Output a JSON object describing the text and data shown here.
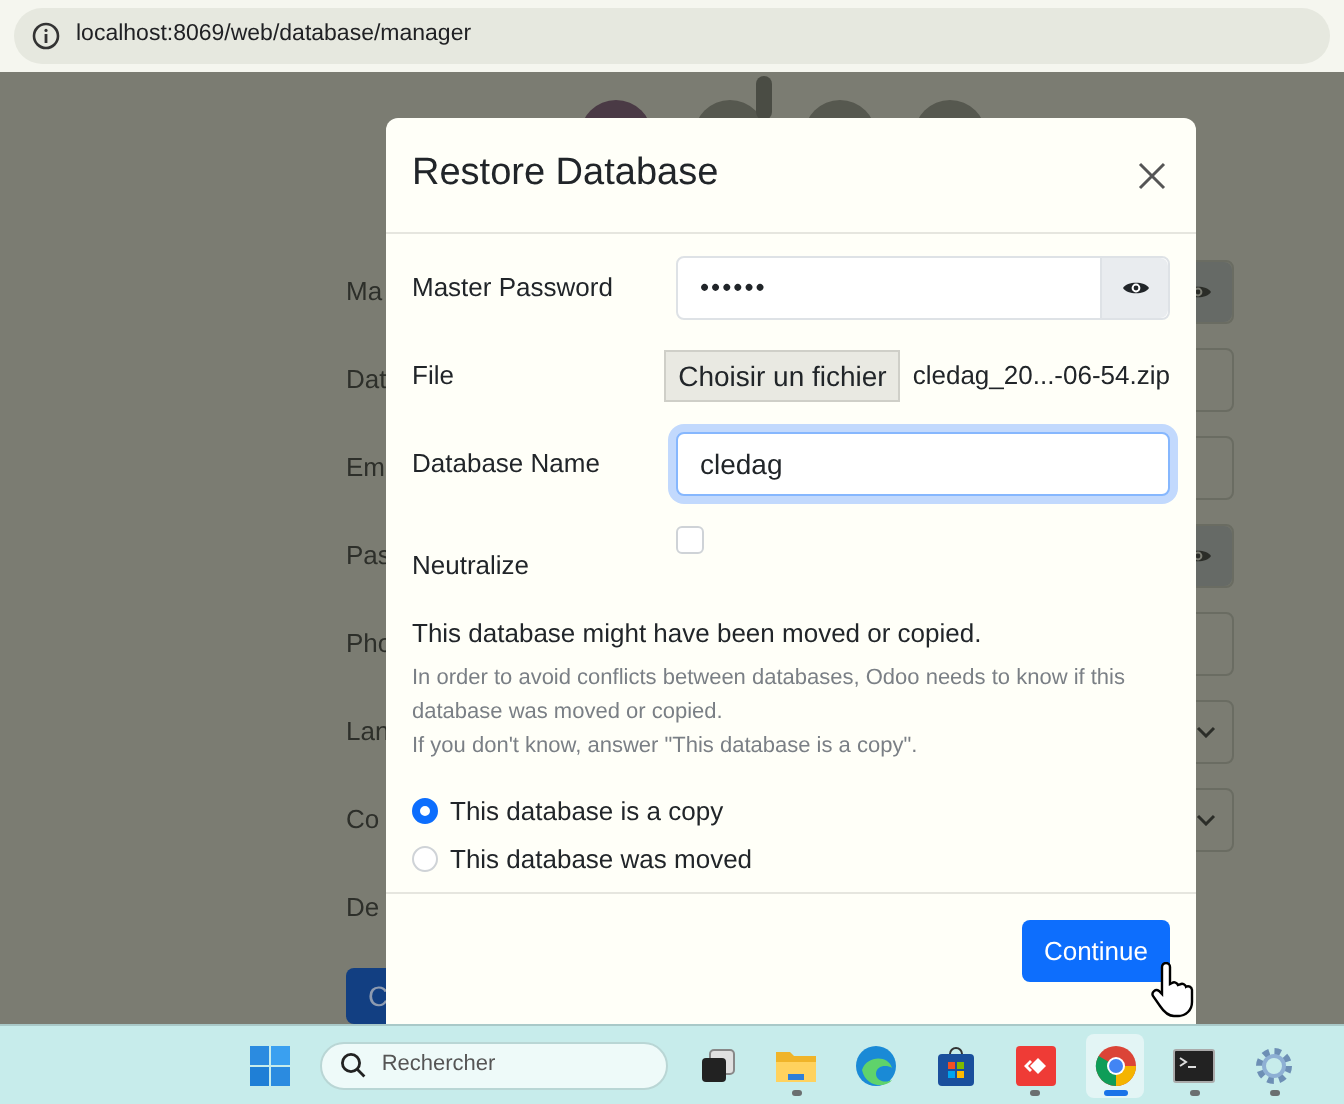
{
  "address_bar": {
    "url": "localhost:8069/web/database/manager"
  },
  "background_form": {
    "rows": [
      {
        "label": "Ma",
        "kind": "password"
      },
      {
        "label": "Dat",
        "kind": "text"
      },
      {
        "label": "Em",
        "kind": "text"
      },
      {
        "label": "Pas",
        "kind": "password"
      },
      {
        "label": "Pho",
        "kind": "text"
      },
      {
        "label": "Lan",
        "kind": "select"
      },
      {
        "label": "Co",
        "kind": "select"
      },
      {
        "label": "De",
        "kind": "plain"
      }
    ],
    "button": "C"
  },
  "modal": {
    "title": "Restore Database",
    "fields": [
      {
        "label": "Master Password",
        "kind": "password",
        "value": "••••••"
      },
      {
        "label": "File",
        "kind": "file",
        "button": "Choisir un fichier",
        "value": "cledag_20...-06-54.zip"
      },
      {
        "label": "Database Name",
        "kind": "text",
        "value": "cledag",
        "focused": true
      },
      {
        "label": "Neutralize",
        "kind": "checkbox",
        "checked": false
      }
    ],
    "notice": {
      "heading": "This database might have been moved or copied.",
      "lines": [
        "In order to avoid conflicts between databases, Odoo needs to know if this database was moved or copied.",
        "If you don't know, answer \"This database is a copy\"."
      ]
    },
    "options": [
      {
        "label": "This database is a copy",
        "selected": true
      },
      {
        "label": "This database was moved",
        "selected": false
      }
    ],
    "continue_button": "Continue"
  },
  "taskbar": {
    "search": {
      "placeholder": "Rechercher"
    },
    "apps": [
      {
        "kind": "start",
        "open": false,
        "selected": false
      },
      {
        "kind": "taskview",
        "open": false,
        "selected": false
      },
      {
        "kind": "folder",
        "open": true,
        "selected": false
      },
      {
        "kind": "edge",
        "open": false,
        "selected": false
      },
      {
        "kind": "store",
        "open": false,
        "selected": false
      },
      {
        "kind": "remote",
        "open": true,
        "selected": false
      },
      {
        "kind": "chrome",
        "open": true,
        "selected": true
      },
      {
        "kind": "terminal",
        "open": true,
        "selected": false
      },
      {
        "kind": "settings",
        "open": true,
        "selected": false
      }
    ]
  }
}
